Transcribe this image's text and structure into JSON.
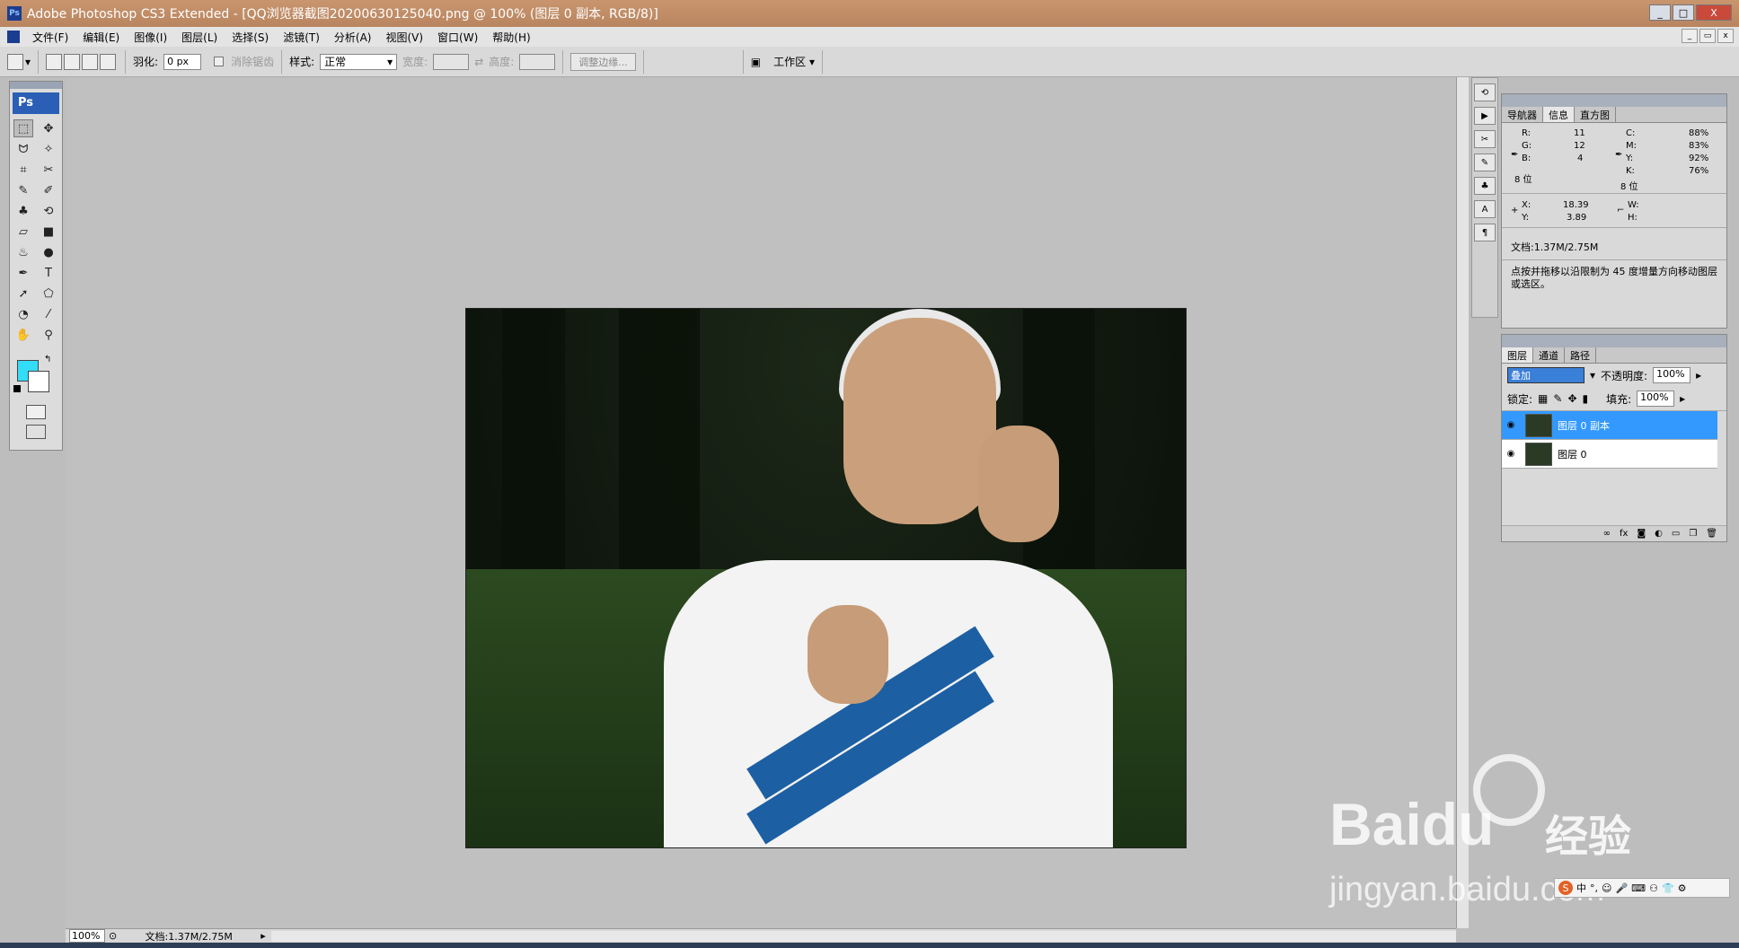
{
  "window": {
    "title": "Adobe Photoshop CS3 Extended - [QQ浏览器截图20200630125040.png @ 100% (图层 0 副本, RGB/8)]",
    "controls": [
      "_",
      "□",
      "X"
    ]
  },
  "menu": {
    "items": [
      "文件(F)",
      "编辑(E)",
      "图像(I)",
      "图层(L)",
      "选择(S)",
      "滤镜(T)",
      "分析(A)",
      "视图(V)",
      "窗口(W)",
      "帮助(H)"
    ]
  },
  "options": {
    "feather_label": "羽化:",
    "feather_value": "0 px",
    "antialias_label": "消除锯齿",
    "style_label": "样式:",
    "style_value": "正常",
    "width_label": "宽度:",
    "height_label": "高度:",
    "refine_edge": "调整边缘...",
    "workspace": "工作区"
  },
  "toolbox": {
    "logo": "Ps",
    "tools": [
      "marquee-tool",
      "move-tool",
      "lasso-tool",
      "magic-wand-tool",
      "crop-tool",
      "slice-tool",
      "healing-brush-tool",
      "brush-tool",
      "clone-stamp-tool",
      "history-brush-tool",
      "eraser-tool",
      "gradient-tool",
      "blur-tool",
      "dodge-tool",
      "pen-tool",
      "type-tool",
      "path-selection-tool",
      "shape-tool",
      "3d-rotate-tool",
      "eyedropper-tool",
      "hand-tool",
      "zoom-tool"
    ],
    "tool_glyphs": [
      "⬚",
      "✥",
      "ᗢ",
      "✧",
      "⌗",
      "✂",
      "✎",
      "✐",
      "♣",
      "⟲",
      "▱",
      "■",
      "♨",
      "●",
      "✒",
      "T",
      "➚",
      "⬠",
      "◔",
      "⁄",
      "✋",
      "⚲"
    ],
    "foreground_color": "#33ddf8",
    "background_color": "#ffffff"
  },
  "status": {
    "zoom": "100%",
    "doc": "文档:1.37M/2.75M"
  },
  "info_panel": {
    "tabs": [
      "导航器",
      "信息",
      "直方图"
    ],
    "r_label": "R:",
    "r": "11",
    "g_label": "G:",
    "g": "12",
    "b_label": "B:",
    "b": "4",
    "bits_left": "8 位",
    "c_label": "C:",
    "c": "88%",
    "m_label": "M:",
    "m": "83%",
    "y_label": "Y:",
    "y": "92%",
    "k_label": "K:",
    "k": "76%",
    "bits_right": "8 位",
    "x_label": "X:",
    "x": "18.39",
    "yy_label": "Y:",
    "yy": "3.89",
    "w_label": "W:",
    "h_label": "H:",
    "doc": "文档:1.37M/2.75M",
    "hint": "点按并拖移以沿限制为 45 度增量方向移动图层或选区。"
  },
  "layers_panel": {
    "tabs": [
      "图层",
      "通道",
      "路径"
    ],
    "blend_mode": "叠加",
    "opacity_label": "不透明度:",
    "opacity": "100%",
    "lock_label": "锁定:",
    "fill_label": "填充:",
    "fill": "100%",
    "layers": [
      {
        "name": "图层 0 副本",
        "selected": true
      },
      {
        "name": "图层 0",
        "selected": false
      }
    ],
    "bottom_icons": [
      "link-icon",
      "fx-icon",
      "mask-icon",
      "adjustment-icon",
      "folder-icon",
      "new-layer-icon",
      "trash-icon"
    ]
  },
  "watermark": {
    "brand": "Bai",
    "brand_end": "du",
    "cn": "经验",
    "url": "jingyan.baidu.com"
  },
  "ime": {
    "logo": "S"
  }
}
